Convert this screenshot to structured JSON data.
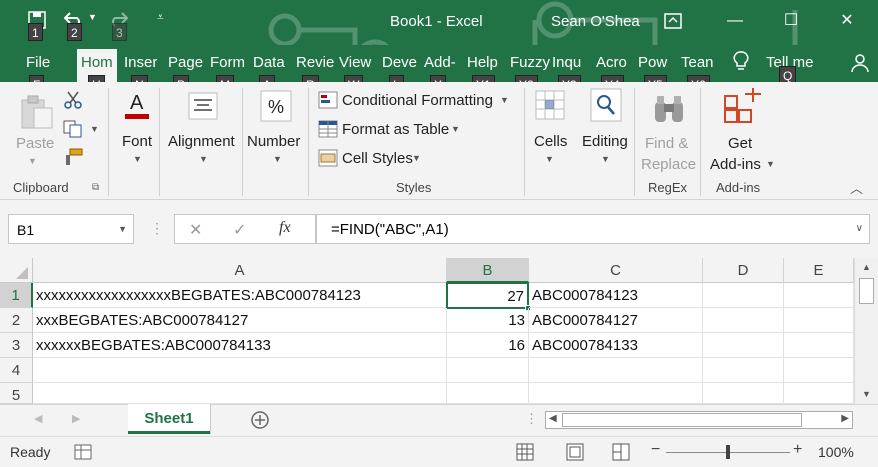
{
  "window": {
    "title": "Book1  -  Excel",
    "user": "Sean O'Shea"
  },
  "qat_keytips": [
    "1",
    "2",
    "3"
  ],
  "tabs": [
    {
      "label": "File",
      "keytip": "F"
    },
    {
      "label": "Hom",
      "keytip": "H",
      "active": true
    },
    {
      "label": "Inser",
      "keytip": "N"
    },
    {
      "label": "Page",
      "keytip": "P"
    },
    {
      "label": "Form",
      "keytip": "M"
    },
    {
      "label": "Data",
      "keytip": "A"
    },
    {
      "label": "Revie",
      "keytip": "R"
    },
    {
      "label": "View",
      "keytip": "W"
    },
    {
      "label": "Deve",
      "keytip": "L"
    },
    {
      "label": "Add-",
      "keytip": "X"
    },
    {
      "label": "Help",
      "keytip": "Y1"
    },
    {
      "label": "Fuzzy",
      "keytip": "Y2"
    },
    {
      "label": "Inqu",
      "keytip": "Y3"
    },
    {
      "label": "Acro",
      "keytip": "Y4"
    },
    {
      "label": "Pow",
      "keytip": "Y5"
    },
    {
      "label": "Tean",
      "keytip": "Y6"
    },
    {
      "label": "Tell me",
      "keytip": "Q"
    }
  ],
  "ribbon": {
    "clipboard": {
      "paste": "Paste",
      "group": "Clipboard"
    },
    "font": "Font",
    "alignment": "Alignment",
    "number": "Number",
    "styles": {
      "conditional": "Conditional Formatting",
      "format_table": "Format as Table",
      "cell_styles": "Cell Styles",
      "group": "Styles"
    },
    "cells": "Cells",
    "editing": "Editing",
    "regex": {
      "find": "Find &",
      "replace": "Replace",
      "group": "RegEx"
    },
    "addins": {
      "get": "Get",
      "addins": "Add-ins",
      "group": "Add-ins"
    }
  },
  "formula_bar": {
    "name_box": "B1",
    "fx": "fx",
    "formula": "=FIND(\"ABC\",A1)"
  },
  "grid": {
    "columns": [
      "A",
      "B",
      "C",
      "D",
      "E"
    ],
    "rows": [
      {
        "num": "1",
        "a": "xxxxxxxxxxxxxxxxxxBEGBATES:ABC000784123",
        "b": "27",
        "c": "ABC000784123"
      },
      {
        "num": "2",
        "a": "xxxBEGBATES:ABC000784127",
        "b": "13",
        "c": "ABC000784127"
      },
      {
        "num": "3",
        "a": "xxxxxxBEGBATES:ABC000784133",
        "b": "16",
        "c": "ABC000784133"
      },
      {
        "num": "4",
        "a": "",
        "b": "",
        "c": ""
      },
      {
        "num": "5",
        "a": "",
        "b": "",
        "c": ""
      }
    ]
  },
  "sheets": [
    "Sheet1"
  ],
  "status": {
    "ready": "Ready",
    "zoom": "100%"
  },
  "colors": {
    "accent": "#217346"
  }
}
